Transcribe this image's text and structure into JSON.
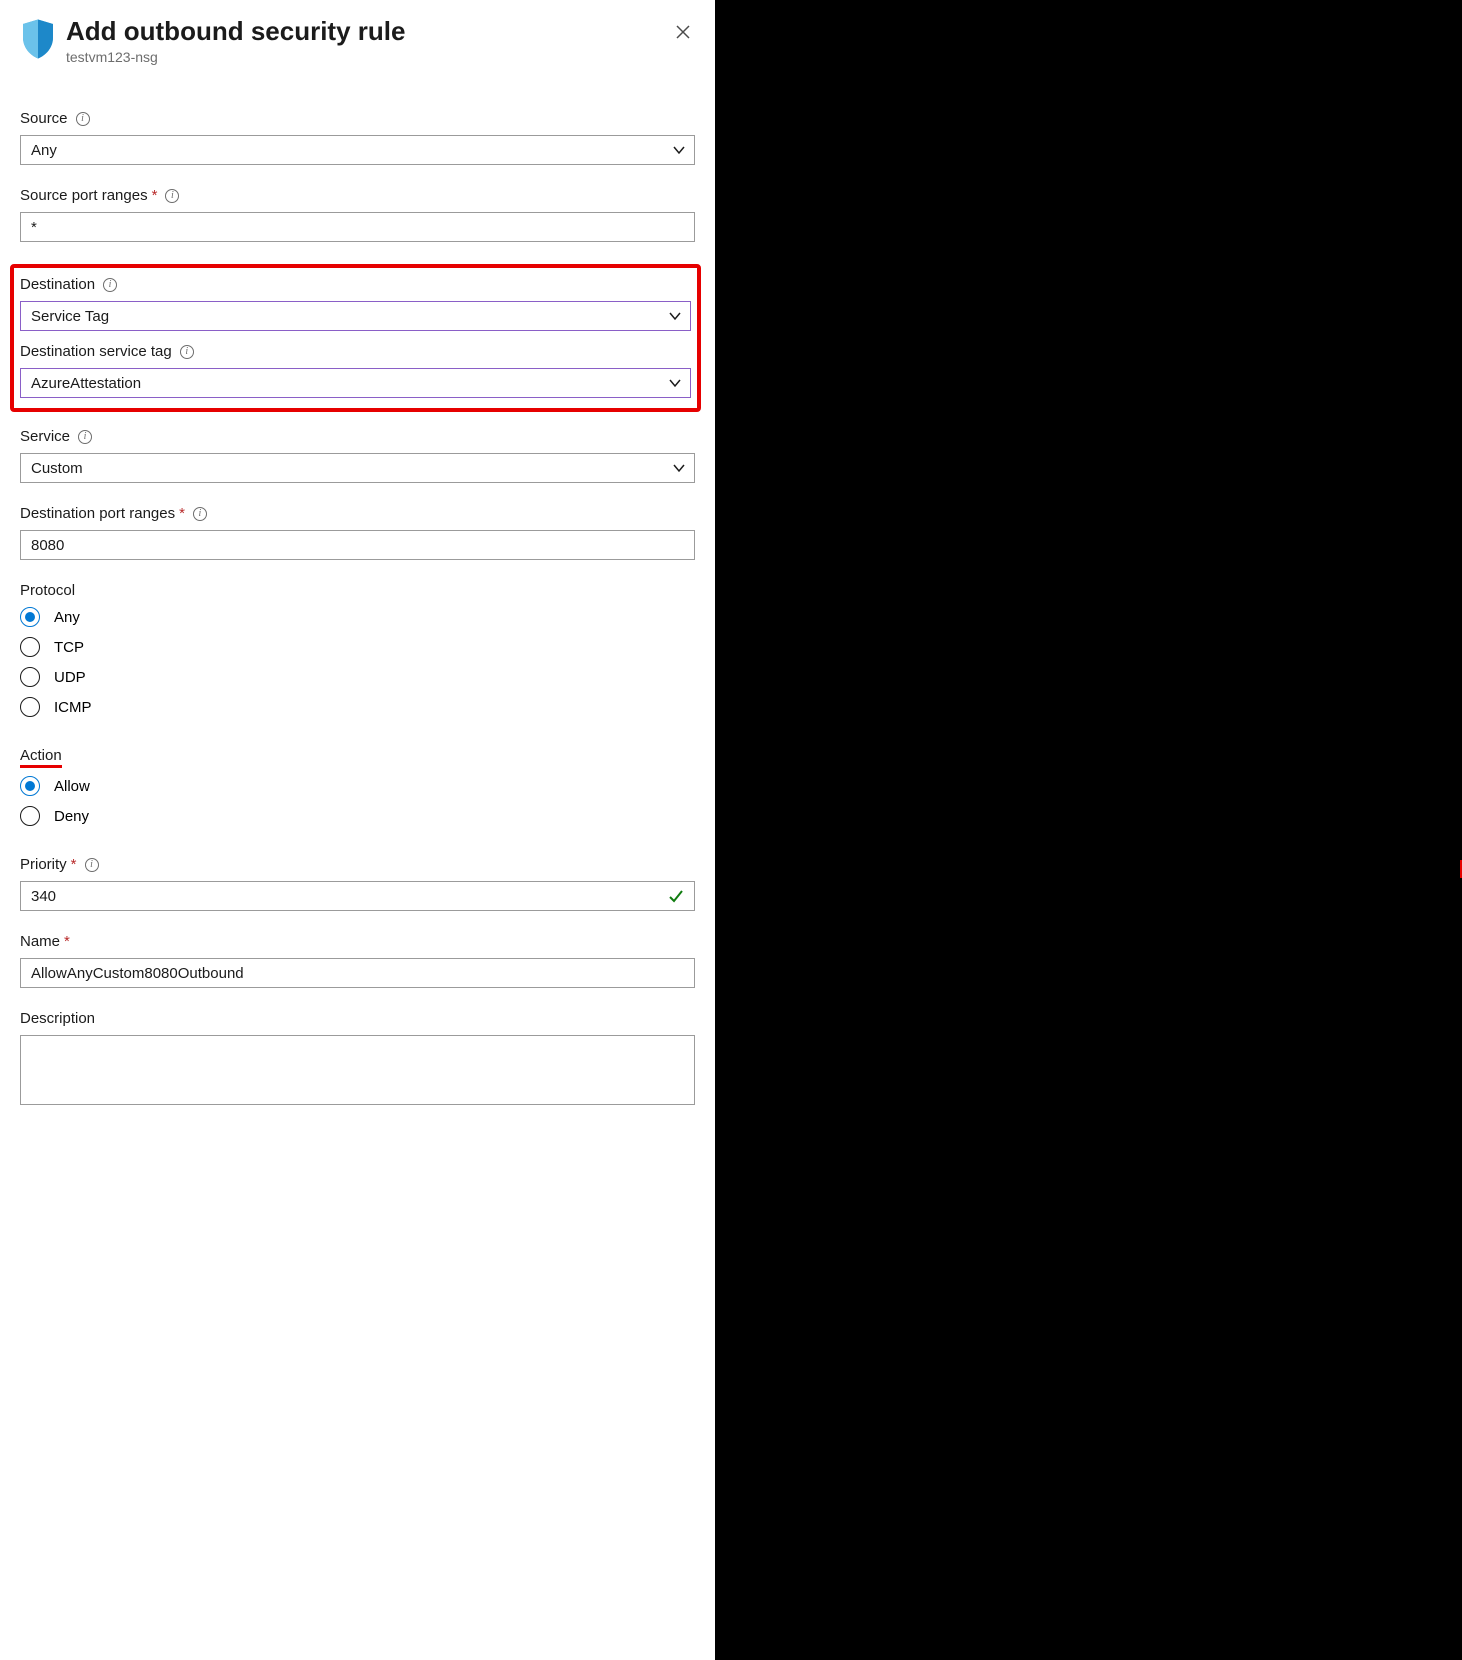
{
  "header": {
    "title": "Add outbound security rule",
    "subtitle": "testvm123-nsg"
  },
  "fields": {
    "source": {
      "label": "Source",
      "value": "Any"
    },
    "sourcePortRanges": {
      "label": "Source port ranges",
      "value": "*"
    },
    "destination": {
      "label": "Destination",
      "value": "Service Tag"
    },
    "destServiceTag": {
      "label": "Destination service tag",
      "value": "AzureAttestation"
    },
    "service": {
      "label": "Service",
      "value": "Custom"
    },
    "destPortRanges": {
      "label": "Destination port ranges",
      "value": "8080"
    },
    "protocol": {
      "label": "Protocol",
      "options": [
        "Any",
        "TCP",
        "UDP",
        "ICMP"
      ],
      "value": "Any"
    },
    "action": {
      "label": "Action",
      "options": [
        "Allow",
        "Deny"
      ],
      "value": "Allow"
    },
    "priority": {
      "label": "Priority",
      "value": "340"
    },
    "name": {
      "label": "Name",
      "value": "AllowAnyCustom8080Outbound"
    },
    "description": {
      "label": "Description",
      "value": ""
    }
  }
}
